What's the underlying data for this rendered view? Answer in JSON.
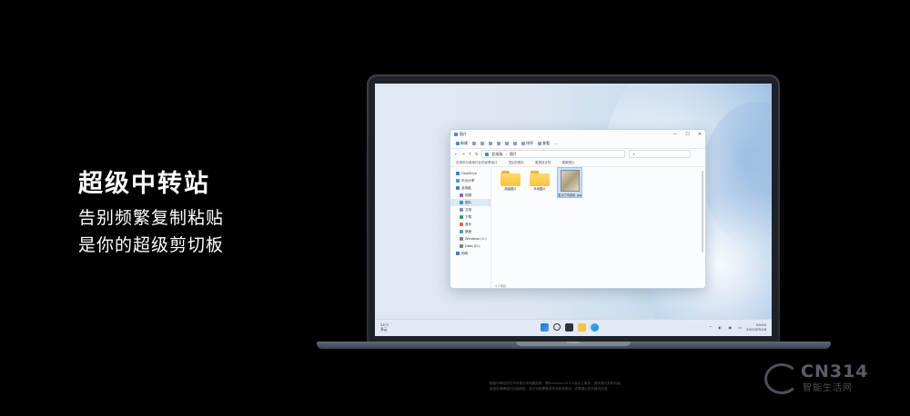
{
  "headline": {
    "title": "超级中转站",
    "line1": "告别频繁复制粘贴",
    "line2": "是你的超级剪切板"
  },
  "laptop": {
    "brand": "HUAWEI"
  },
  "window": {
    "title": "图片",
    "toolbar": {
      "new": "新建",
      "sort": "排序",
      "view": "查看"
    },
    "address": {
      "path1": "此电脑",
      "path2": "图片"
    },
    "favorites": [
      "在资讯与商用行业的优秀设计",
      "顶尖的照片",
      "更具设计的",
      "更新照片"
    ],
    "sidebar": [
      {
        "label": "OneDrive",
        "icon": "cloud-icon",
        "color": "#2f7fd6",
        "sub": false
      },
      {
        "label": "华为分享",
        "icon": "share-icon",
        "color": "#3a9be0",
        "sub": false
      },
      {
        "label": "此电脑",
        "icon": "pc-icon",
        "color": "#4a78b5",
        "sub": false
      },
      {
        "label": "视频",
        "icon": "video-icon",
        "color": "#8a5cc6",
        "sub": true
      },
      {
        "label": "图片",
        "icon": "pictures-icon",
        "color": "#3b8bd9",
        "sub": true,
        "selected": true
      },
      {
        "label": "文档",
        "icon": "documents-icon",
        "color": "#7a8ea6",
        "sub": true
      },
      {
        "label": "下载",
        "icon": "download-icon",
        "color": "#2e9d5f",
        "sub": true
      },
      {
        "label": "音乐",
        "icon": "music-icon",
        "color": "#e0663a",
        "sub": true
      },
      {
        "label": "桌面",
        "icon": "desktop-icon",
        "color": "#3d9ad8",
        "sub": true
      },
      {
        "label": "Windows (C:)",
        "icon": "drive-icon",
        "color": "#6f7f90",
        "sub": true
      },
      {
        "label": "Data (D:)",
        "icon": "drive-icon",
        "color": "#6f7f90",
        "sub": true
      },
      {
        "label": "网络",
        "icon": "network-icon",
        "color": "#4a78b5",
        "sub": false
      }
    ],
    "files": [
      {
        "name": "超级图片",
        "type": "folder"
      },
      {
        "name": "本地图片",
        "type": "folder"
      },
      {
        "name": "重点方向图片.jpg",
        "type": "image"
      }
    ],
    "status": "3 个项目"
  },
  "taskbar": {
    "weather_temp": "24°C",
    "weather_desc": "多云",
    "time": "00:00",
    "date": "2022/05/18"
  },
  "disclaimer": {
    "line1": "超级中转站仅在华为笔记本电脑适用，需HarmonyOS 2.0及以上版本，具体请以实际为准。",
    "line2": "使用前请确保已连接网络，部分功能需登录华为帐号使用，详情请以实际情况为准。"
  },
  "watermark": {
    "site": "CN314",
    "sub": "智能生活网"
  }
}
